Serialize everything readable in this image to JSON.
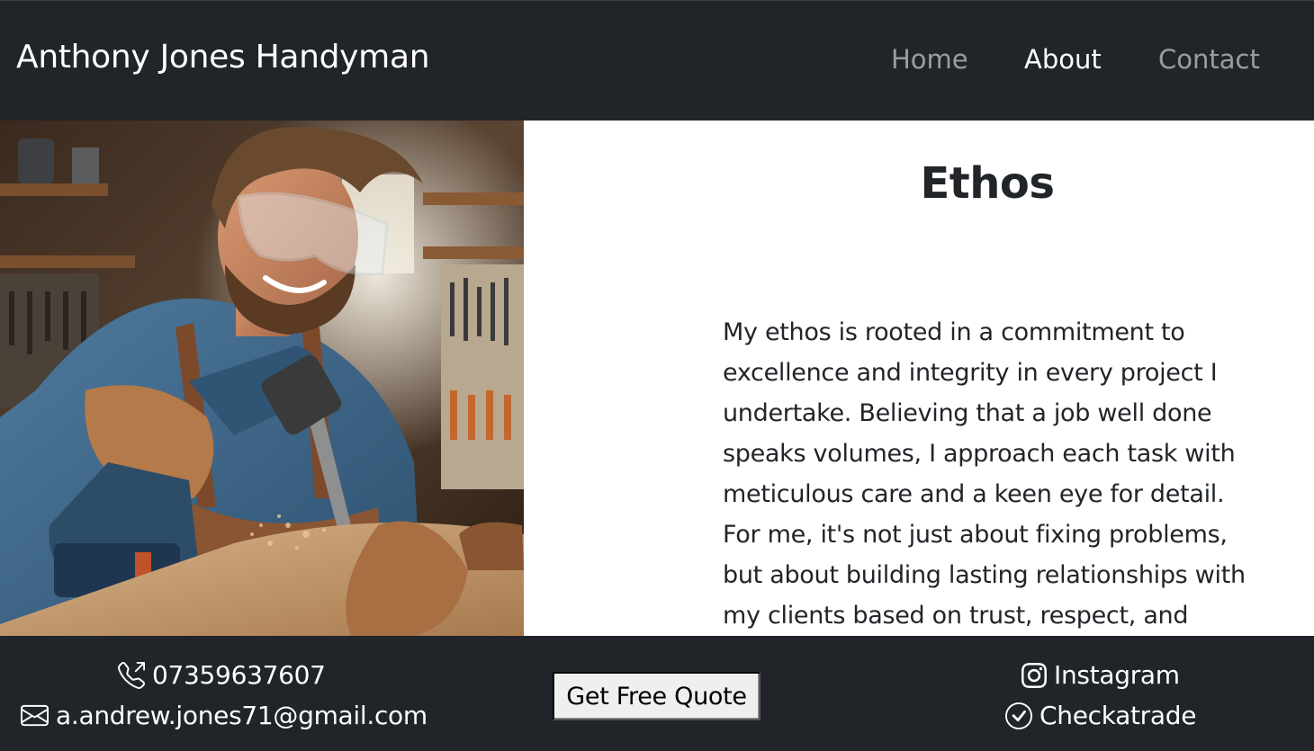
{
  "navbar": {
    "brand": "Anthony Jones Handyman",
    "links": [
      {
        "label": "Home",
        "active": false
      },
      {
        "label": "About",
        "active": true
      },
      {
        "label": "Contact",
        "active": false
      }
    ]
  },
  "hero": {
    "image_alt": "Handyman wearing safety glasses and work gloves drilling into wood in a workshop"
  },
  "ethos": {
    "title": "Ethos",
    "text": "My ethos is rooted in a commitment to excellence and integrity in every project I undertake. Believing that a job well done speaks volumes, I approach each task with meticulous care and a keen eye for detail. For me, it's not just about fixing problems, but about building lasting relationships with my clients based on trust, respect, and"
  },
  "footer": {
    "phone": "07359637607",
    "email": "a.andrew.jones71@gmail.com",
    "quote_button": "Get Free Quote",
    "instagram": "Instagram",
    "checkatrade": "Checkatrade"
  },
  "colors": {
    "navbar_bg": "#212529",
    "footer_bg": "#212529",
    "text_dark": "#212529",
    "nav_inactive": "rgba(255,255,255,0.55)",
    "nav_active": "#ffffff"
  },
  "icons": {
    "phone": "telephone-outbound-icon",
    "email": "envelope-icon",
    "instagram": "instagram-icon",
    "checkatrade": "check-circle-icon"
  }
}
